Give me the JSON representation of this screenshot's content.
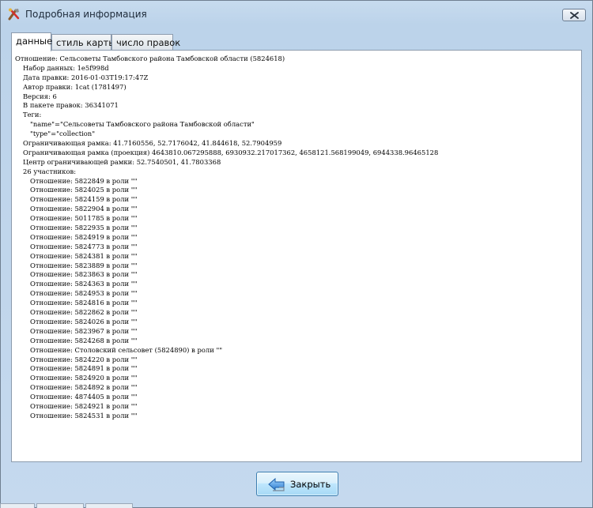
{
  "window": {
    "title": "Подробная информация",
    "close_icon": "close-x-icon",
    "app_icon": "josm-tools-icon"
  },
  "tabs": [
    {
      "label": "данные",
      "active": true
    },
    {
      "label": "стиль карты",
      "active": false
    },
    {
      "label": "число правок",
      "active": false
    }
  ],
  "content": {
    "header": "Отношение: Сельсоветы Тамбовского района Тамбовской области (5824618)",
    "dataset": "Набор данных: 1e5f998d",
    "edit_date": "Дата правки: 2016-01-03T19:17:47Z",
    "author": "Автор правки: 1cat (1781497)",
    "version": "Версия: 6",
    "changeset": "В пакете правок: 36341071",
    "tags_label": "Теги:",
    "tags": [
      "\"name\"=\"Сельсоветы Тамбовского района Тамбовской области\"",
      "\"type\"=\"collection\""
    ],
    "bbox": "Ограничивающая рамка: 41.7160556, 52.7176042, 41.844618, 52.7904959",
    "bbox_projected": "Ограничивающая рамка (проекция) 4643810.067295888, 6930932.217017362, 4658121.568199049, 6944338.96465128",
    "bbox_center": "Центр ограничивающей рамки: 52.7540501, 41.7803368",
    "members_label": "26 участников:",
    "members": [
      "Отношение: 5822849 в роли \"\"",
      "Отношение: 5824025 в роли \"\"",
      "Отношение: 5824159 в роли \"\"",
      "Отношение: 5822904 в роли \"\"",
      "Отношение: 5011785 в роли \"\"",
      "Отношение: 5822935 в роли \"\"",
      "Отношение: 5824919 в роли \"\"",
      "Отношение: 5824773 в роли \"\"",
      "Отношение: 5824381 в роли \"\"",
      "Отношение: 5823889 в роли \"\"",
      "Отношение: 5823863 в роли \"\"",
      "Отношение: 5824363 в роли \"\"",
      "Отношение: 5824953 в роли \"\"",
      "Отношение: 5824816 в роли \"\"",
      "Отношение: 5822862 в роли \"\"",
      "Отношение: 5824026 в роли \"\"",
      "Отношение: 5823967 в роли \"\"",
      "Отношение: 5824268 в роли \"\"",
      "Отношение: Столовский сельсовет (5824890) в роли \"\"",
      "Отношение: 5824220 в роли \"\"",
      "Отношение: 5824891 в роли \"\"",
      "Отношение: 5824920 в роли \"\"",
      "Отношение: 5824892 в роли \"\"",
      "Отношение: 4874405 в роли \"\"",
      "Отношение: 5824921 в роли \"\"",
      "Отношение: 5824531 в роли \"\""
    ]
  },
  "footer": {
    "close_label": "Закрыть",
    "close_icon": "arrow-back-icon"
  }
}
